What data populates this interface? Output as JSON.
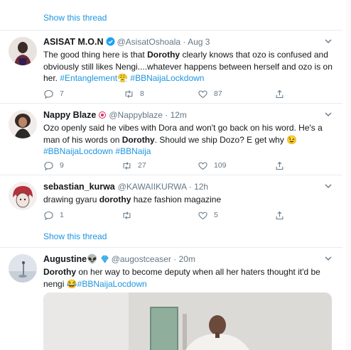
{
  "show_thread_label_1": "Show this thread",
  "show_thread_label_2": "Show this thread",
  "tweets": [
    {
      "name": "ASISAT M.O.N",
      "handle": "@AsisatOshoala",
      "time": "Aug 3",
      "body_parts": [
        "The good thing here is that ",
        "Dorothy",
        " clearly knows that ozo is confused and obviously still likes Nengi....whatever happens between herself and ozo is on her. ",
        "#Entanglement",
        "😤",
        " ",
        "#BBNaijaLockdown"
      ],
      "replies": "7",
      "retweets": "8",
      "likes": "87"
    },
    {
      "name": "Nappy Blaze",
      "handle": "@Nappyblaze",
      "time": "12m",
      "body_parts": [
        "Ozo openly said he vibes with Dora and won't go back on his word. He's a man of his words on ",
        "Dorothy",
        ". Should we ship Dozo? E get why ",
        "😉",
        "#BBNaijaLocdown",
        " ",
        "#BBNaija"
      ],
      "replies": "9",
      "retweets": "27",
      "likes": "109"
    },
    {
      "name": "sebastian_kurwa",
      "handle": "@KAWAIIKURWA",
      "time": "12h",
      "body_parts": [
        "drawing gyaru ",
        "dorothy",
        " haze fashion magazine"
      ],
      "replies": "1",
      "retweets": "",
      "likes": "5"
    },
    {
      "name": "Augustine👽",
      "handle": "@augostceaser",
      "time": "20m",
      "body_parts": [
        "Dorothy",
        " on her way to become deputy when all her haters thought it'd be nengi ",
        "😂",
        "#BBNaijaLocdown"
      ]
    }
  ],
  "colors": {
    "accent": "#1b95e0",
    "muted": "#657786",
    "text": "#14171a",
    "divider": "#e6ecf0",
    "verified": "#1da1f2"
  },
  "icons": [
    "reply-icon",
    "retweet-icon",
    "like-icon",
    "share-icon",
    "chevron-down-icon",
    "verified-badge-icon",
    "bunny-badge-icon",
    "diamond-badge-icon"
  ]
}
